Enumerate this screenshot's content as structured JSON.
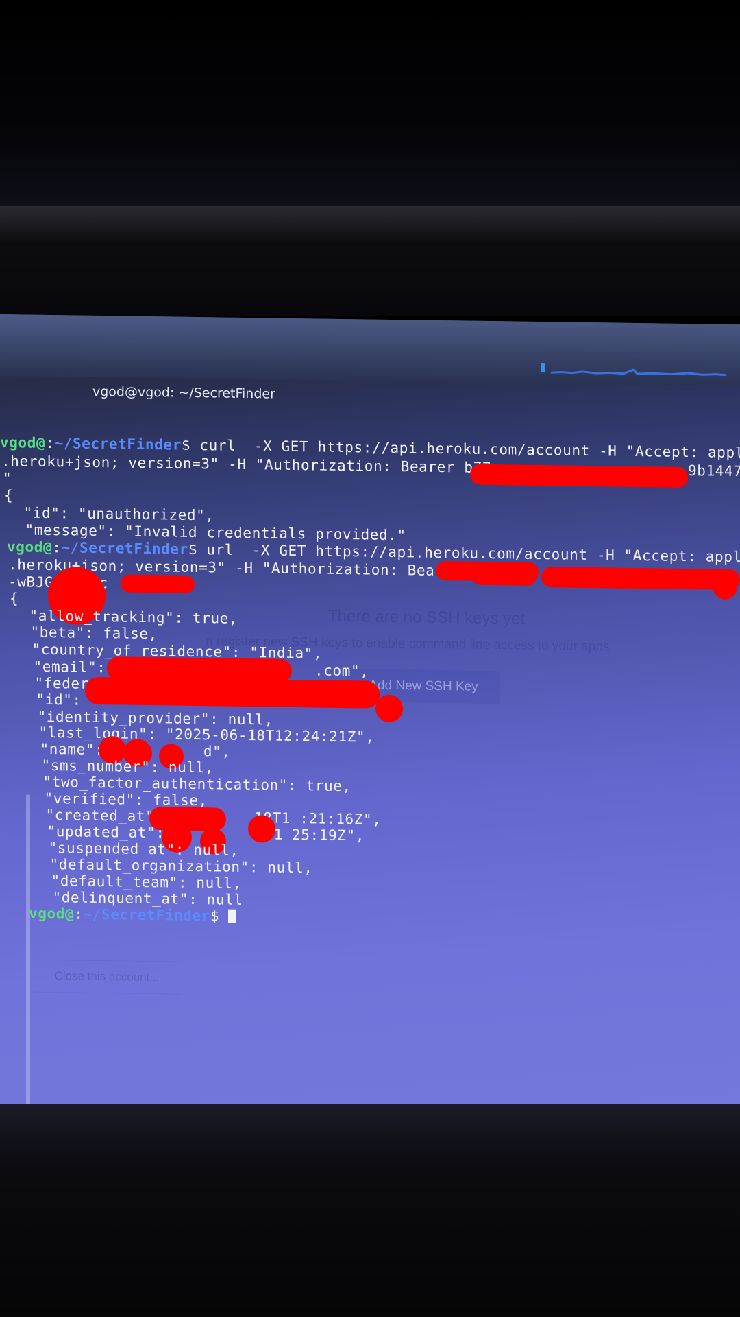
{
  "window": {
    "title": "vgod@vgod: ~/SecretFinder"
  },
  "background_page": {
    "heading": "There are no SSH keys yet",
    "subtext": "n register new SSH keys to enable command line access to your apps",
    "add_button": "Add New SSH Key",
    "close_button": "Close this account..."
  },
  "terminal": {
    "prompt_user": "vgod@",
    "prompt_sep": ":",
    "prompt_path": "~/SecretFinder",
    "prompt_symbol": "$",
    "cmd1_line1": " curl  -X GET https://api.heroku.com/account -H \"Accept: appli",
    "cmd1_line2": ".heroku+json; version=3\" -H \"Authorization: Bearer b77",
    "cmd1_line2_tail": "9b1447",
    "cmd1_line3": "\"",
    "resp1": [
      "{",
      "  \"id\": \"unauthorized\",",
      "  \"message\": \"Invalid credentials provided.\""
    ],
    "cmd2_line1": " url  -X GET https://api.heroku.com/account -H \"Accept: applic",
    "cmd2_line2": ".heroku+json; version=3\" -H \"Authorization: Bearer",
    "cmd2_line3": "-wBJG    wc       E\"",
    "resp2": [
      "{",
      "  \"allow_tracking\": true,",
      "  \"beta\": false,",
      "  \"country_of_residence\": \"India\",",
      "  \"email\": \"                     .com\",",
      "  \"federated\": false,",
      "  \"id\": \"",
      "  \"identity_provider\": null,",
      "  \"last_login\": \"2025-06-18T12:24:21Z\",",
      "  \"name\": \"         d\",",
      "  \"sms_number\": null,",
      "  \"two_factor_authentication\": true,",
      "  \"verified\": false,",
      "  \"created_at\": \"        18T1 :21:16Z\",",
      "  \"updated_at\": \"        8T1 25:19Z\",",
      "  \"suspended_at\": null,",
      "  \"default_organization\": null,",
      "  \"default_team\": null,",
      "  \"delinquent_at\": null"
    ]
  },
  "colors": {
    "prompt_user": "#59e07f",
    "prompt_path": "#5a8cff",
    "redaction": "#ff0000"
  }
}
